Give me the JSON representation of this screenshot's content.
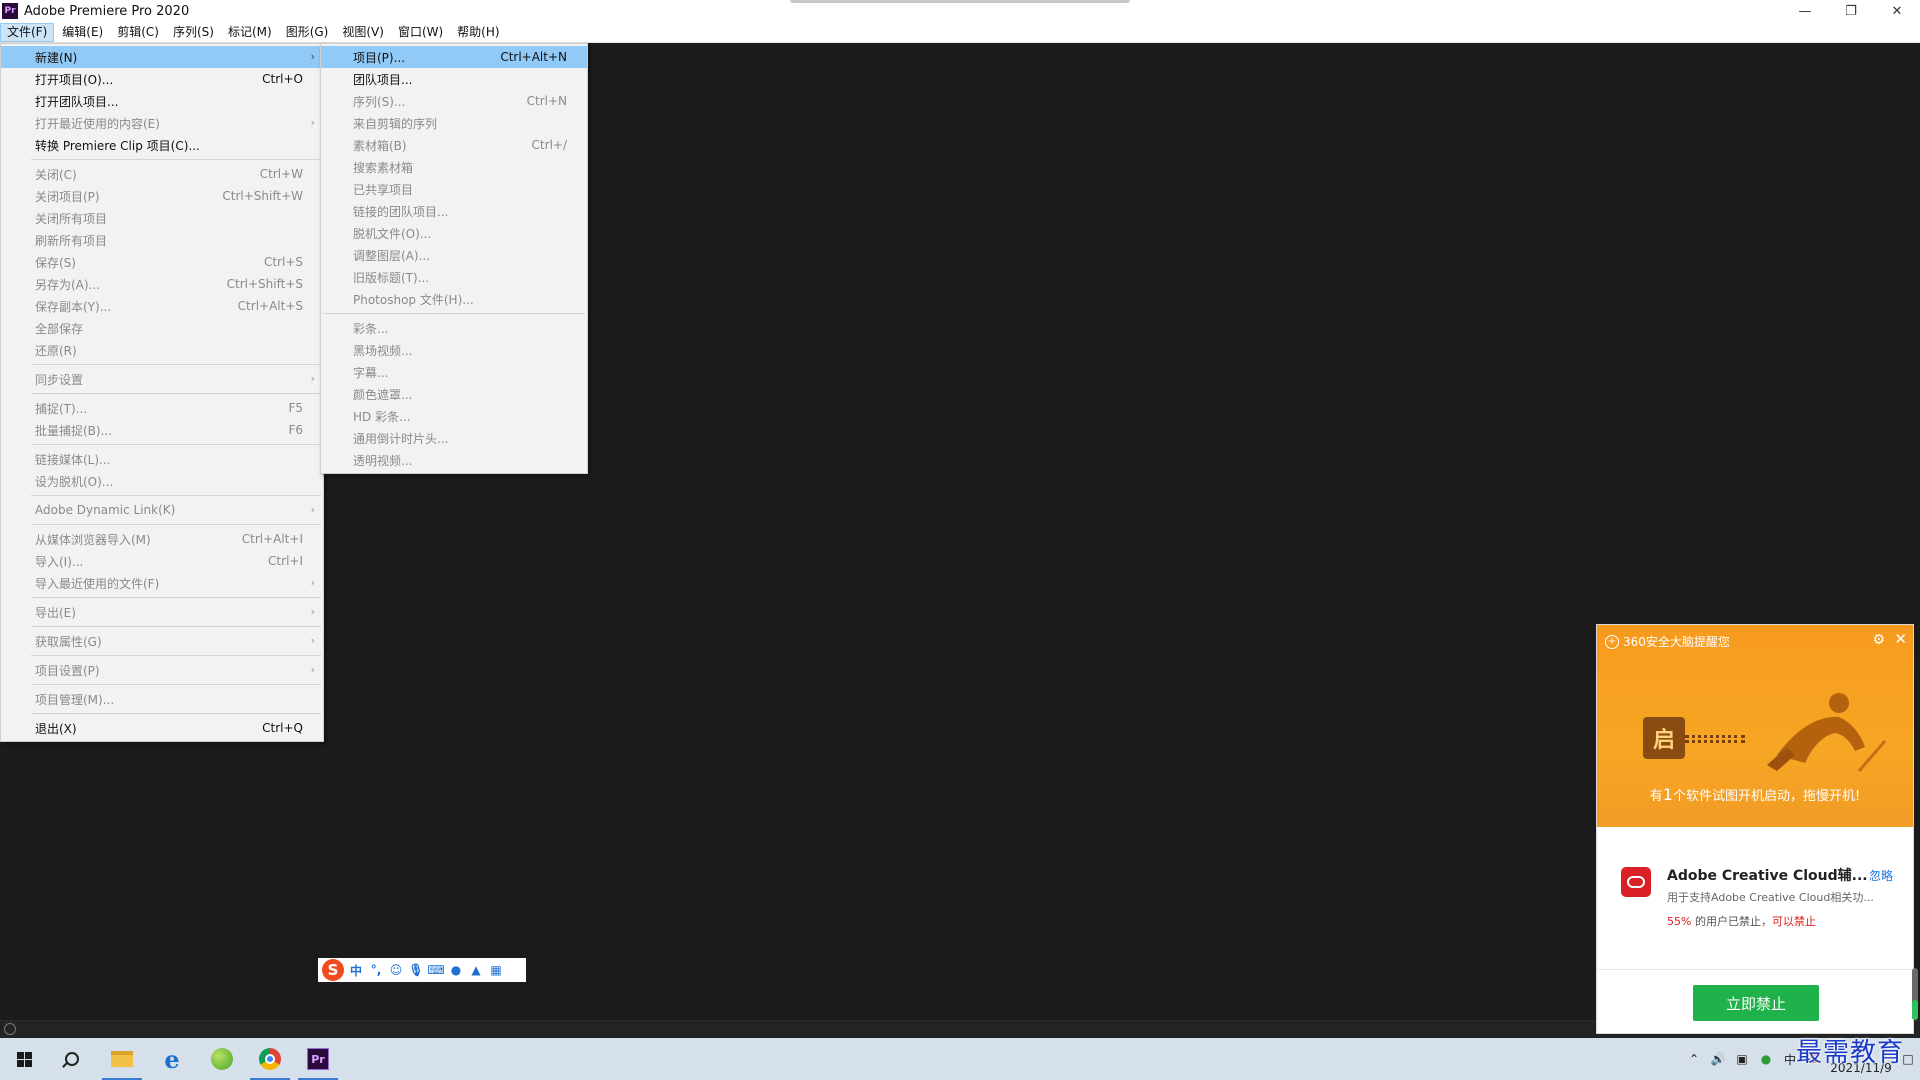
{
  "window": {
    "title": "Adobe Premiere Pro 2020",
    "app_icon": "Pr",
    "controls": [
      "minimize-icon",
      "maximize-icon",
      "close-icon"
    ]
  },
  "menubar": [
    "文件(F)",
    "编辑(E)",
    "剪辑(C)",
    "序列(S)",
    "标记(M)",
    "图形(G)",
    "视图(V)",
    "窗口(W)",
    "帮助(H)"
  ],
  "file_menu": {
    "items": [
      {
        "label": "新建(N)",
        "shortcut": "",
        "submenu": true,
        "disabled": false,
        "highlight": true
      },
      {
        "label": "打开项目(O)...",
        "shortcut": "Ctrl+O",
        "submenu": false,
        "disabled": false
      },
      {
        "label": "打开团队项目...",
        "shortcut": "",
        "submenu": false,
        "disabled": false
      },
      {
        "label": "打开最近使用的内容(E)",
        "shortcut": "",
        "submenu": true,
        "disabled": true
      },
      {
        "label": "转换 Premiere Clip 项目(C)...",
        "shortcut": "",
        "submenu": false,
        "disabled": false
      },
      {
        "sep": true
      },
      {
        "label": "关闭(C)",
        "shortcut": "Ctrl+W",
        "submenu": false,
        "disabled": true
      },
      {
        "label": "关闭项目(P)",
        "shortcut": "Ctrl+Shift+W",
        "submenu": false,
        "disabled": true
      },
      {
        "label": "关闭所有项目",
        "shortcut": "",
        "submenu": false,
        "disabled": true
      },
      {
        "label": "刷新所有项目",
        "shortcut": "",
        "submenu": false,
        "disabled": true
      },
      {
        "label": "保存(S)",
        "shortcut": "Ctrl+S",
        "submenu": false,
        "disabled": true
      },
      {
        "label": "另存为(A)...",
        "shortcut": "Ctrl+Shift+S",
        "submenu": false,
        "disabled": true
      },
      {
        "label": "保存副本(Y)...",
        "shortcut": "Ctrl+Alt+S",
        "submenu": false,
        "disabled": true
      },
      {
        "label": "全部保存",
        "shortcut": "",
        "submenu": false,
        "disabled": true
      },
      {
        "label": "还原(R)",
        "shortcut": "",
        "submenu": false,
        "disabled": true
      },
      {
        "sep": true
      },
      {
        "label": "同步设置",
        "shortcut": "",
        "submenu": true,
        "disabled": true
      },
      {
        "sep": true
      },
      {
        "label": "捕捉(T)...",
        "shortcut": "F5",
        "submenu": false,
        "disabled": true
      },
      {
        "label": "批量捕捉(B)...",
        "shortcut": "F6",
        "submenu": false,
        "disabled": true
      },
      {
        "sep": true
      },
      {
        "label": "链接媒体(L)...",
        "shortcut": "",
        "submenu": false,
        "disabled": true
      },
      {
        "label": "设为脱机(O)...",
        "shortcut": "",
        "submenu": false,
        "disabled": true
      },
      {
        "sep": true
      },
      {
        "label": "Adobe Dynamic Link(K)",
        "shortcut": "",
        "submenu": true,
        "disabled": true
      },
      {
        "sep": true
      },
      {
        "label": "从媒体浏览器导入(M)",
        "shortcut": "Ctrl+Alt+I",
        "submenu": false,
        "disabled": true
      },
      {
        "label": "导入(I)...",
        "shortcut": "Ctrl+I",
        "submenu": false,
        "disabled": true
      },
      {
        "label": "导入最近使用的文件(F)",
        "shortcut": "",
        "submenu": true,
        "disabled": true
      },
      {
        "sep": true
      },
      {
        "label": "导出(E)",
        "shortcut": "",
        "submenu": true,
        "disabled": true
      },
      {
        "sep": true
      },
      {
        "label": "获取属性(G)",
        "shortcut": "",
        "submenu": true,
        "disabled": true
      },
      {
        "sep": true
      },
      {
        "label": "项目设置(P)",
        "shortcut": "",
        "submenu": true,
        "disabled": true
      },
      {
        "sep": true
      },
      {
        "label": "项目管理(M)...",
        "shortcut": "",
        "submenu": false,
        "disabled": true
      },
      {
        "sep": true
      },
      {
        "label": "退出(X)",
        "shortcut": "Ctrl+Q",
        "submenu": false,
        "disabled": false
      }
    ]
  },
  "new_submenu": {
    "items": [
      {
        "label": "项目(P)...",
        "shortcut": "Ctrl+Alt+N",
        "disabled": false,
        "highlight": true
      },
      {
        "label": "团队项目...",
        "shortcut": "",
        "disabled": false
      },
      {
        "label": "序列(S)...",
        "shortcut": "Ctrl+N",
        "disabled": true
      },
      {
        "label": "来自剪辑的序列",
        "shortcut": "",
        "disabled": true
      },
      {
        "label": "素材箱(B)",
        "shortcut": "Ctrl+/",
        "disabled": true
      },
      {
        "label": "搜索素材箱",
        "shortcut": "",
        "disabled": true
      },
      {
        "label": "已共享项目",
        "shortcut": "",
        "disabled": true
      },
      {
        "label": "链接的团队项目...",
        "shortcut": "",
        "disabled": true
      },
      {
        "label": "脱机文件(O)...",
        "shortcut": "",
        "disabled": true
      },
      {
        "label": "调整图层(A)...",
        "shortcut": "",
        "disabled": true
      },
      {
        "label": "旧版标题(T)...",
        "shortcut": "",
        "disabled": true
      },
      {
        "label": "Photoshop 文件(H)...",
        "shortcut": "",
        "disabled": true
      },
      {
        "sep": true
      },
      {
        "label": "彩条...",
        "shortcut": "",
        "disabled": true
      },
      {
        "label": "黑场视频...",
        "shortcut": "",
        "disabled": true
      },
      {
        "label": "字幕...",
        "shortcut": "",
        "disabled": true
      },
      {
        "label": "颜色遮罩...",
        "shortcut": "",
        "disabled": true
      },
      {
        "label": "HD 彩条...",
        "shortcut": "",
        "disabled": true
      },
      {
        "label": "通用倒计时片头...",
        "shortcut": "",
        "disabled": true
      },
      {
        "label": "透明视频...",
        "shortcut": "",
        "disabled": true
      }
    ]
  },
  "ime_toolbar": {
    "logo": "S",
    "mode": "中",
    "icons": [
      "punctuation-icon",
      "emoji-icon",
      "microphone-icon",
      "keyboard-icon",
      "user-icon",
      "skin-icon",
      "toolbox-icon"
    ]
  },
  "popup_360": {
    "header": "360安全大脑提醒您",
    "lock_char": "启",
    "headline_pre": "有",
    "headline_num": "1",
    "headline_post": "个软件试图开机启动，拖慢开机!",
    "app_name": "Adobe Creative Cloud辅...",
    "ignore": "忽略",
    "desc": "用于支持Adobe Creative Cloud相关功...",
    "pct": "55%",
    "stat_mid": " 的用户已禁止，",
    "can_ban": "可以禁止",
    "button": "立即禁止",
    "accent": "#f79a1e",
    "button_color": "#1fb14a"
  },
  "taskbar": {
    "apps": [
      "start-icon",
      "search-icon",
      "file-explorer-icon",
      "edge-icon",
      "green-app-icon",
      "chrome-icon",
      "premiere-icon"
    ],
    "date": "2021/11/9",
    "tray_icons": [
      "chevron-up-icon",
      "volume-icon",
      "network-icon",
      "security-icon",
      "ime-icon",
      "sogou-icon"
    ]
  },
  "watermark": "最需教育"
}
